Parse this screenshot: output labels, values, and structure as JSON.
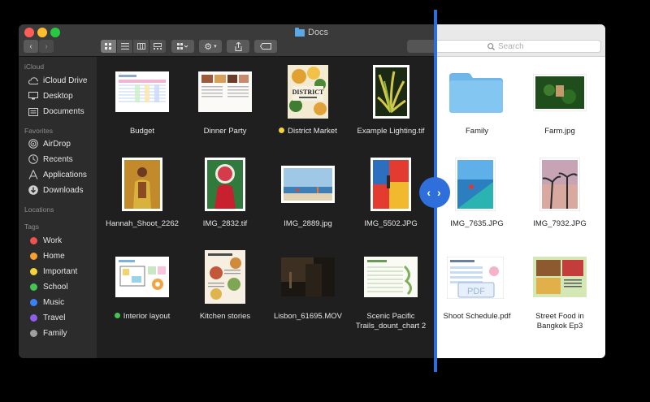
{
  "window": {
    "title": "Docs"
  },
  "search": {
    "placeholder": "Search"
  },
  "sidebar": {
    "sections": {
      "icloud": "iCloud",
      "favorites": "Favorites",
      "locations": "Locations",
      "tags": "Tags"
    },
    "icloud_items": [
      {
        "label": "iCloud Drive",
        "icon": "cloud-icon"
      },
      {
        "label": "Desktop",
        "icon": "desktop-icon"
      },
      {
        "label": "Documents",
        "icon": "document-icon"
      }
    ],
    "favorite_items": [
      {
        "label": "AirDrop",
        "icon": "airdrop-icon"
      },
      {
        "label": "Recents",
        "icon": "clock-icon"
      },
      {
        "label": "Applications",
        "icon": "applications-icon"
      },
      {
        "label": "Downloads",
        "icon": "download-icon"
      }
    ],
    "tags": [
      {
        "label": "Work",
        "color": "#f0524f"
      },
      {
        "label": "Home",
        "color": "#f5a030"
      },
      {
        "label": "Important",
        "color": "#f3d23b"
      },
      {
        "label": "School",
        "color": "#43c554"
      },
      {
        "label": "Music",
        "color": "#3b82f6"
      },
      {
        "label": "Travel",
        "color": "#8f5ee8"
      },
      {
        "label": "Family",
        "color": "#a0a0a0"
      }
    ]
  },
  "files": {
    "dark": [
      {
        "name": "Budget"
      },
      {
        "name": "Dinner Party"
      },
      {
        "name": "District Market",
        "tag_color": "#f3d23b"
      },
      {
        "name": "Example Lighting.tif"
      },
      {
        "name": "Hannah_Shoot_2262"
      },
      {
        "name": "IMG_2832.tif"
      },
      {
        "name": "IMG_2889.jpg"
      },
      {
        "name": "IMG_5502.JPG"
      },
      {
        "name": "Interior layout",
        "tag_color": "#43c554"
      },
      {
        "name": "Kitchen stories"
      },
      {
        "name": "Lisbon_61695.MOV"
      },
      {
        "name": "Scenic Pacific",
        "name2": "Trails_dount_chart 2"
      }
    ],
    "light": [
      {
        "name": "Family"
      },
      {
        "name": "Farm.jpg"
      },
      {
        "name": "IMG_7635.JPG"
      },
      {
        "name": "IMG_7932.JPG"
      },
      {
        "name": "Shoot Schedule.pdf"
      },
      {
        "name": "Street Food in",
        "name2": "Bangkok Ep3"
      }
    ]
  },
  "thumb_text": {
    "district": "DISTRICT",
    "pdf": "PDF"
  },
  "divider": {
    "glyph": "‹ ›"
  }
}
